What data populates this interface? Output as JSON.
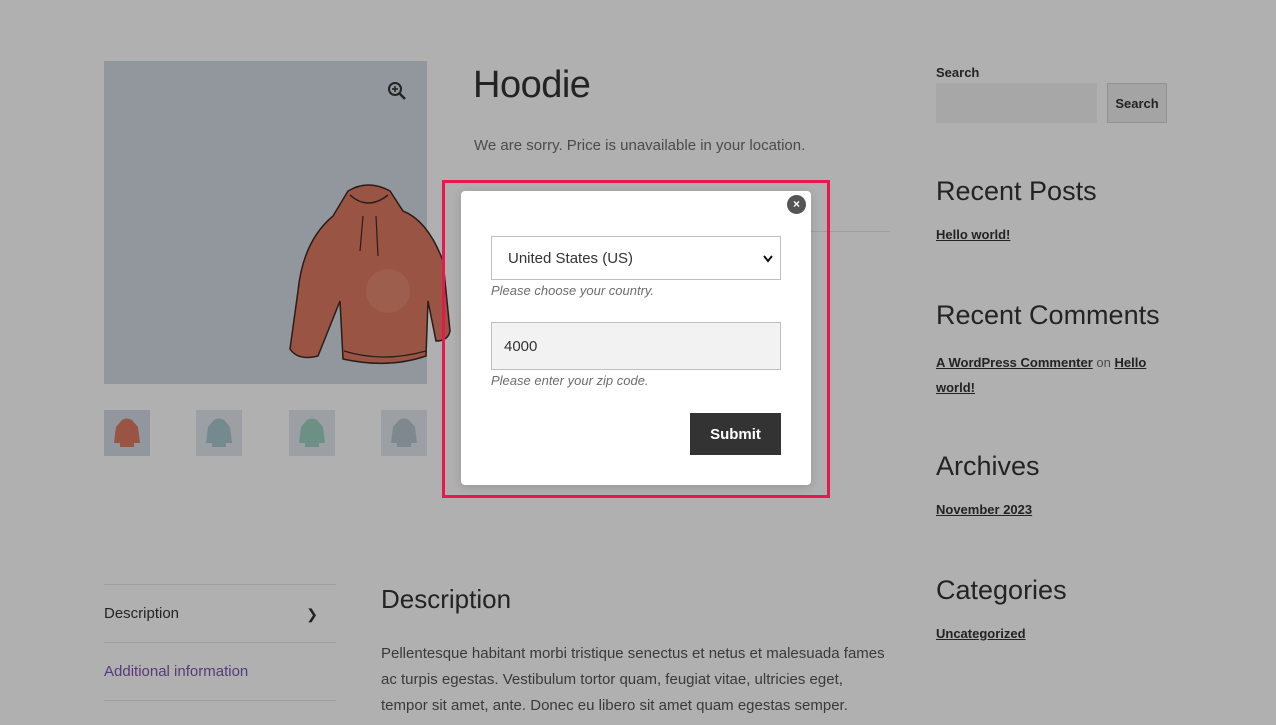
{
  "product": {
    "title": "Hoodie",
    "price_message": "We are sorry. Price is unavailable in your location."
  },
  "icons": {
    "zoom": "magnifier-plus-icon",
    "close": "close-icon",
    "chevron": "chevron-right-icon"
  },
  "colors": {
    "highlight": "#e8174e",
    "button_dark": "#333333",
    "tab_active_link": "#7f54b3"
  },
  "sidebar": {
    "search_label": "Search",
    "search_button": "Search",
    "recent_posts_title": "Recent Posts",
    "recent_posts": [
      "Hello world!"
    ],
    "recent_comments_title": "Recent Comments",
    "comment": {
      "author": "A WordPress Commenter",
      "on": "on",
      "post": "Hello world!"
    },
    "archives_title": "Archives",
    "archives": [
      "November 2023"
    ],
    "categories_title": "Categories",
    "categories": [
      "Uncategorized"
    ]
  },
  "tabs": {
    "items": [
      {
        "label": "Description"
      },
      {
        "label": "Additional information"
      }
    ]
  },
  "description": {
    "title": "Description",
    "text": "Pellentesque habitant morbi tristique senectus et netus et malesuada fames ac turpis egestas. Vestibulum tortor quam, feugiat vitae, ultricies eget, tempor sit amet, ante. Donec eu libero sit amet quam egestas semper."
  },
  "modal": {
    "country_value": "United States (US)",
    "country_help": "Please choose your country.",
    "zip_value": "4000",
    "zip_help": "Please enter your zip code.",
    "submit_label": "Submit",
    "close_glyph": "×"
  }
}
